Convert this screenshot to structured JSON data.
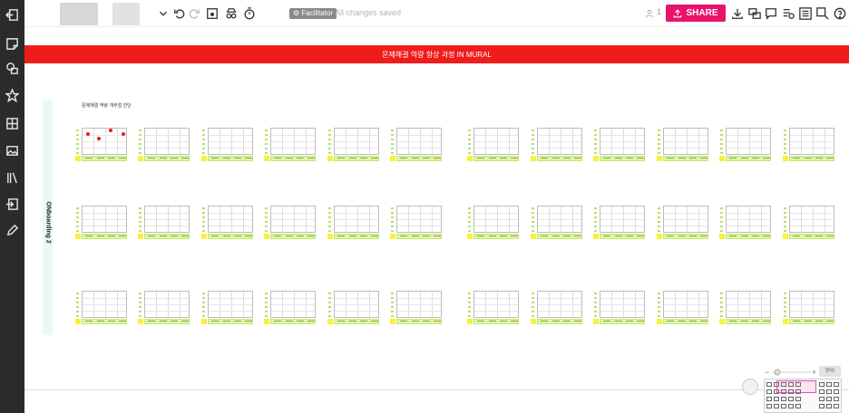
{
  "toolbar": {
    "facilitator_label": "Facilitator",
    "save_status": "All changes saved",
    "user_count": "1",
    "share_label": "SHARE",
    "share_color": "#e8136c"
  },
  "sidebar": {
    "icons": [
      "exit-icon",
      "sticky-note-icon",
      "shapes-icon",
      "star-icon",
      "layout-icon",
      "image-icon",
      "library-icon",
      "import-icon",
      "pen-icon"
    ]
  },
  "canvas": {
    "banner_text": "문제해결 역량 향상 과정 IN MURAL",
    "banner_color": "#f01c1c",
    "frame_label": "ONboarding 2",
    "section_title": "문제해결 역량 개주얼 진단"
  },
  "zoom": {
    "level": "9%"
  }
}
